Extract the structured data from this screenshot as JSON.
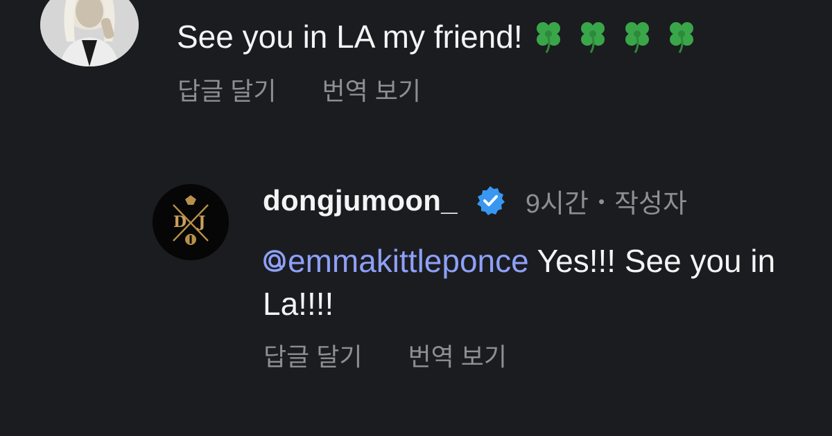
{
  "comments": [
    {
      "avatar_icon": "user-avatar-photo",
      "text": "See you in LA my friend!",
      "emoji": [
        "🍀",
        "🍀",
        "🍀",
        "🍀"
      ],
      "actions": {
        "reply": "답글 달기",
        "translate": "번역 보기"
      }
    }
  ],
  "reply": {
    "avatar_icon": "dj-logo-avatar",
    "username": "dongjumoon_",
    "verified_icon": "verified-badge-icon",
    "time": "9시간",
    "separator": "•",
    "author_label": "작성자",
    "mention": "emmakittleponce",
    "text": " Yes!!! See you in La!!!!",
    "actions": {
      "reply": "답글 달기",
      "translate": "번역 보기"
    }
  },
  "colors": {
    "background": "#1b1c20",
    "text": "#f4f4f4",
    "muted": "#8e8e93",
    "mention": "#8ea0f8",
    "verified": "#3897f0",
    "logo_gold": "#b8904a"
  }
}
